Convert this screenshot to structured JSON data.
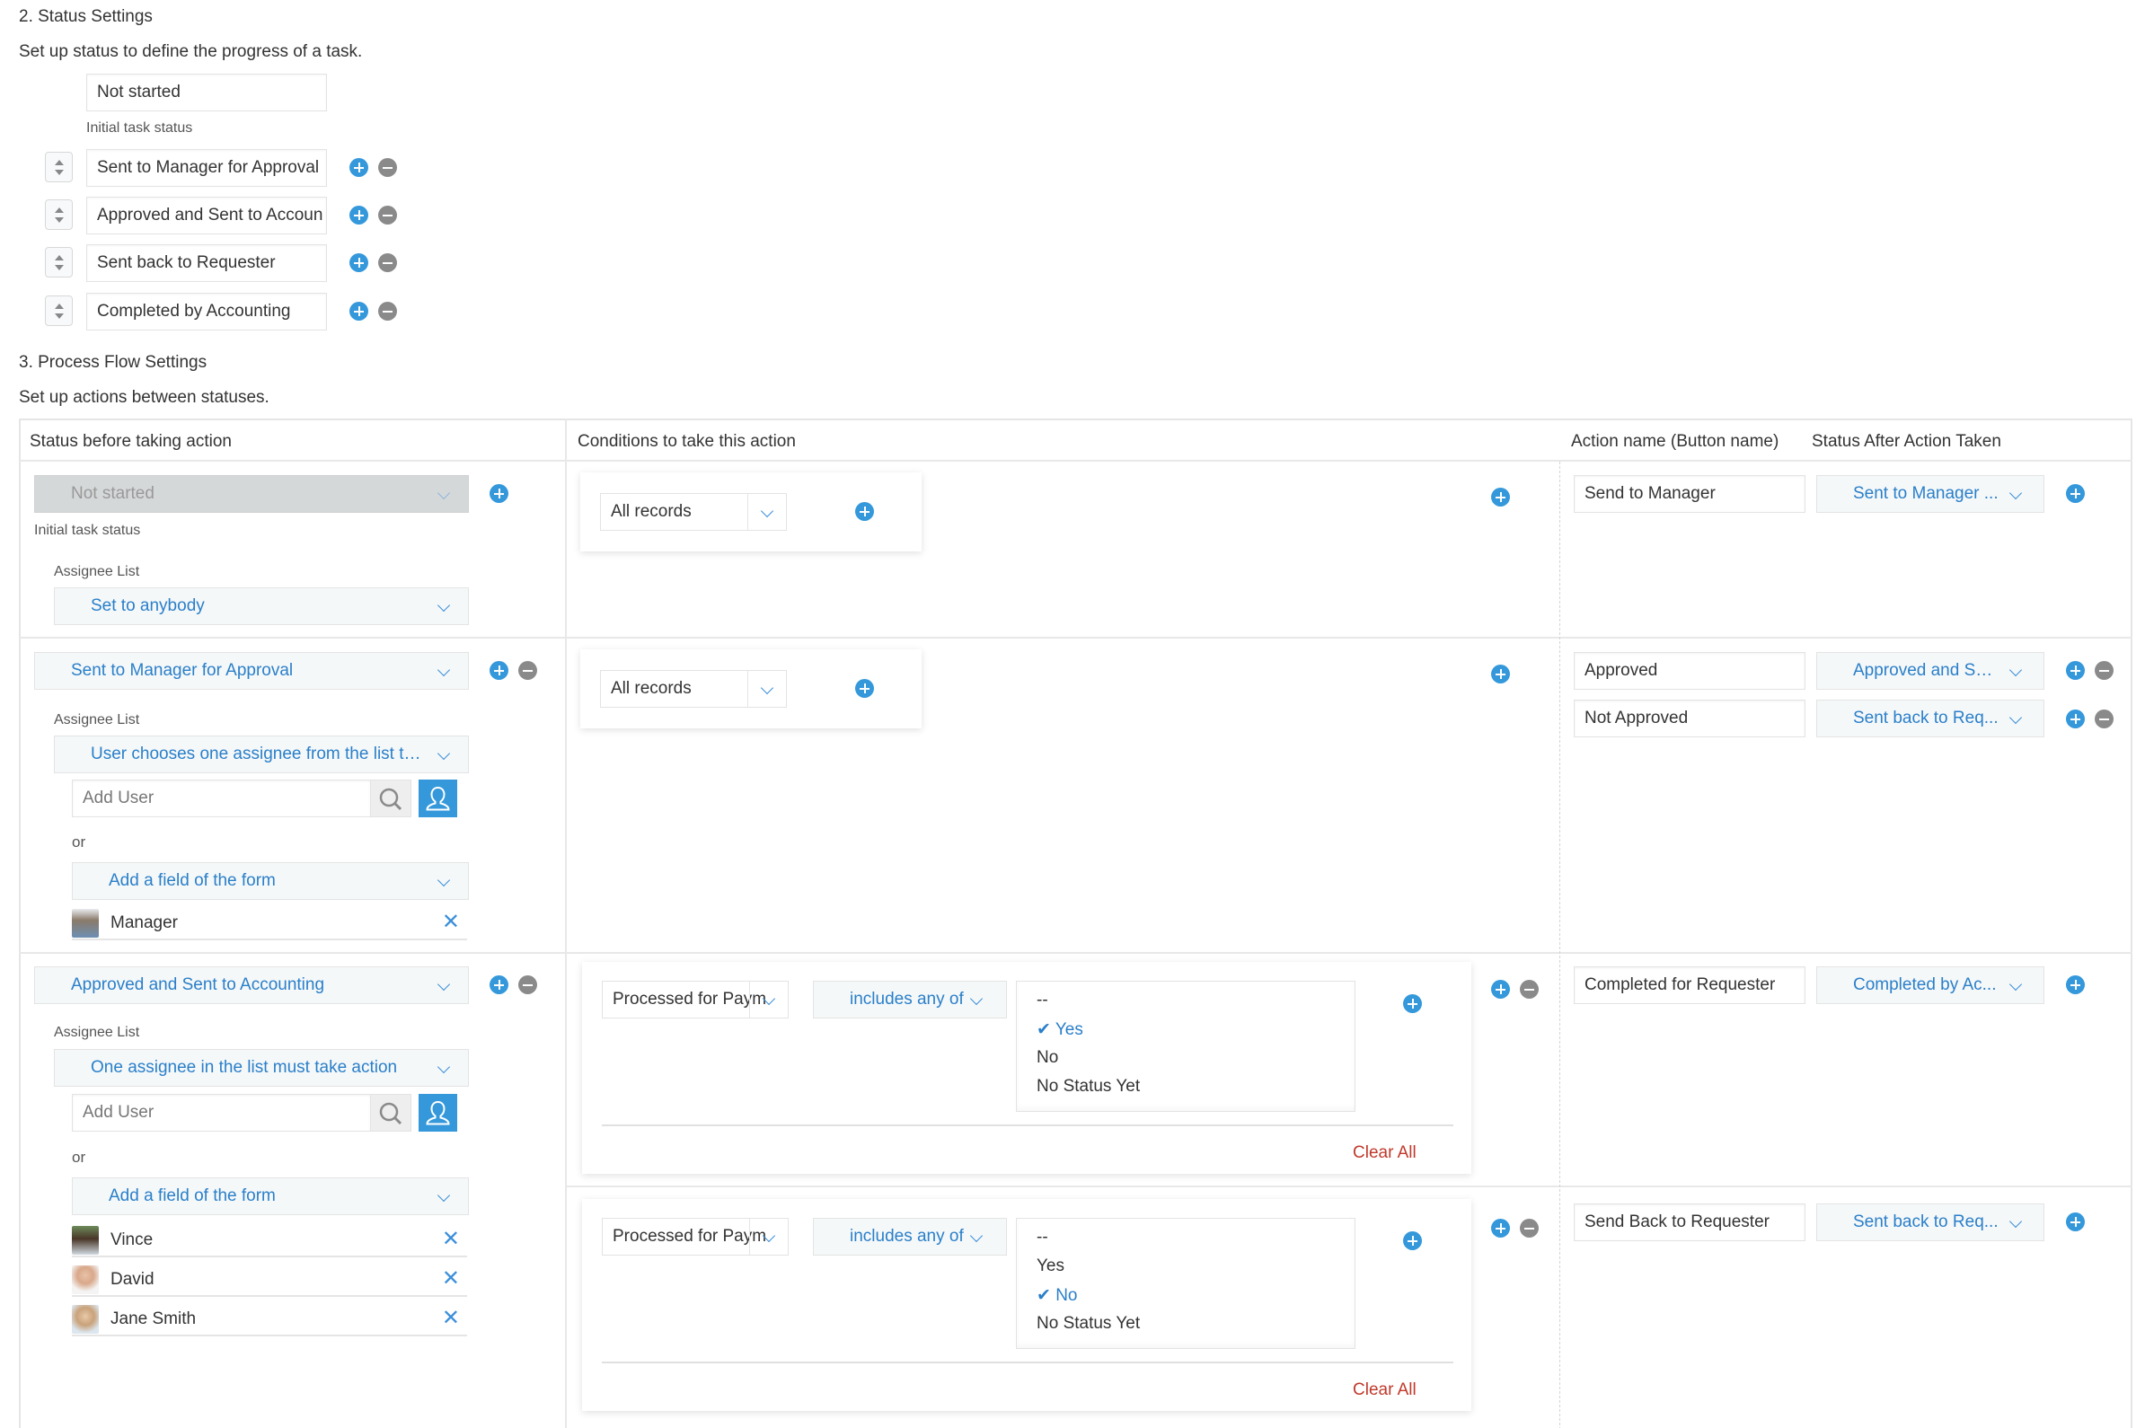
{
  "status_settings": {
    "title": "2. Status Settings",
    "description": "Set up status to define the progress of a task.",
    "initial_status": "Not started",
    "initial_status_label": "Initial task status",
    "statuses": [
      "Sent to Manager for Approval",
      "Approved and Sent to Accoun",
      "Sent back to Requester",
      "Completed by Accounting"
    ]
  },
  "process_flow": {
    "title": "3. Process Flow Settings",
    "description": "Set up actions between statuses.",
    "headers": {
      "status_before": "Status before taking action",
      "conditions": "Conditions to take this action",
      "action_name": "Action name (Button name)",
      "status_after": "Status After Action Taken"
    },
    "common": {
      "assignee_list_label": "Assignee List",
      "initial_status_label": "Initial task status",
      "add_user_placeholder": "Add User",
      "or_label": "or",
      "add_field_label": "Add a field of the form",
      "clear_all": "Clear All"
    },
    "rows": [
      {
        "status_before": "Not started",
        "assignee_mode": "Set to anybody",
        "condition": "All records",
        "actions": [
          {
            "name": "Send to Manager",
            "status_after": "Sent to Manager ..."
          }
        ]
      },
      {
        "status_before": "Sent to Manager for Approval",
        "assignee_mode": "User chooses one assignee from the list to ...",
        "assignees": [
          "Manager"
        ],
        "condition": "All records",
        "actions": [
          {
            "name": "Approved",
            "status_after": "Approved and Se..."
          },
          {
            "name": "Not Approved",
            "status_after": "Sent back to Req..."
          }
        ]
      },
      {
        "status_before": "Approved and Sent to Accounting",
        "assignee_mode": "One assignee in the list must take action",
        "assignees": [
          "Vince",
          "David",
          "Jane Smith"
        ],
        "sub_actions": [
          {
            "field": "Processed for Paym",
            "operator": "includes any of",
            "options": [
              "--",
              "Yes",
              "No",
              "No Status Yet"
            ],
            "selected": "Yes",
            "action_name": "Completed for Requester",
            "status_after": "Completed by Ac..."
          },
          {
            "field": "Processed for Paym",
            "operator": "includes any of",
            "options": [
              "--",
              "Yes",
              "No",
              "No Status Yet"
            ],
            "selected": "No",
            "action_name": "Send Back to Requester",
            "status_after": "Sent back to Req..."
          }
        ]
      }
    ]
  },
  "colors": {
    "accent_blue": "#3498db",
    "link_blue": "#2a7fc9",
    "remove_gray": "#8a8a8a",
    "clear_red": "#c0392b"
  }
}
